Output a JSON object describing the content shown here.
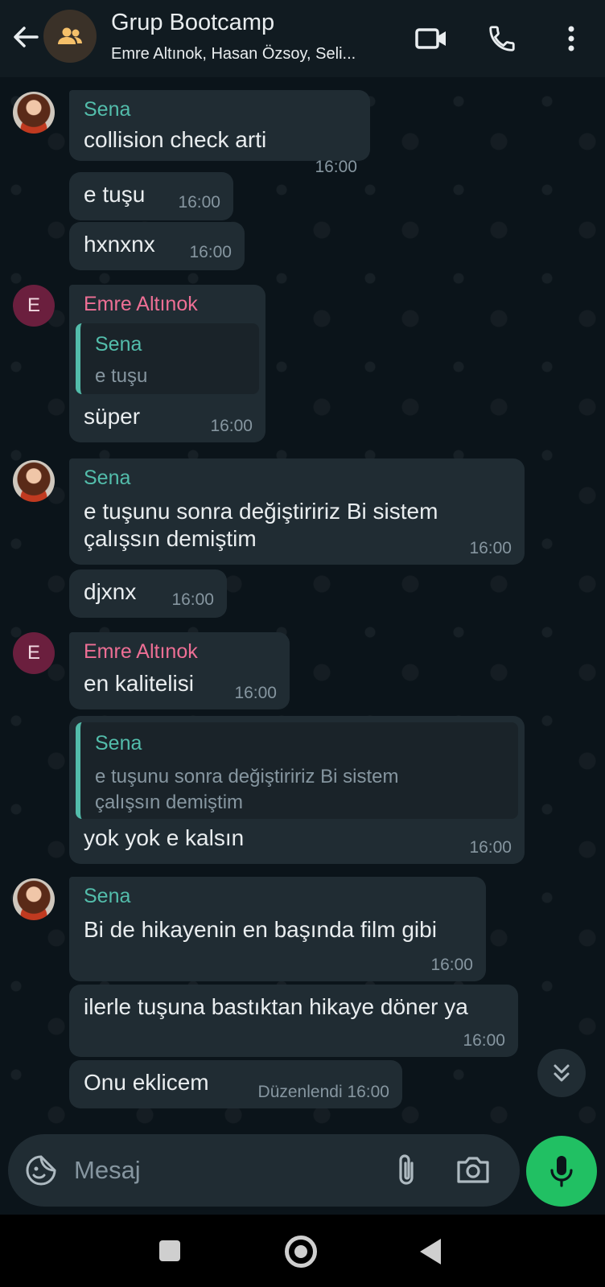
{
  "header": {
    "title": "Grup Bootcamp",
    "subtitle": "Emre Altınok, Hasan Özsoy, Seli..."
  },
  "messages": [
    {
      "sender": "Sena",
      "text": "collision check arti",
      "time": "16:00"
    },
    {
      "text": "e tuşu",
      "time": "16:00"
    },
    {
      "text": "hxnxnx",
      "time": "16:00"
    },
    {
      "sender": "Emre Altınok",
      "avatar_letter": "E",
      "quote": {
        "name": "Sena",
        "text": "e tuşu"
      },
      "text": "süper",
      "time": "16:00"
    },
    {
      "sender": "Sena",
      "text_lines": [
        "e tuşunu sonra değiştiririz Bi sistem",
        "çalışsın demiştim"
      ],
      "time": "16:00"
    },
    {
      "text": "djxnx",
      "time": "16:00"
    },
    {
      "sender": "Emre Altınok",
      "avatar_letter": "E",
      "text": "en kalitelisi",
      "time": "16:00"
    },
    {
      "quote": {
        "name": "Sena",
        "text_lines": [
          "e tuşunu sonra değiştiririz Bi sistem",
          "çalışsın demiştim"
        ]
      },
      "text": "yok yok e kalsın",
      "time": "16:00"
    },
    {
      "sender": "Sena",
      "text": "Bi de hikayenin en başında film gibi",
      "time": "16:00"
    },
    {
      "text": "ilerle tuşuna bastıktan hikaye döner ya",
      "time": "16:00"
    },
    {
      "text": "Onu eklicem",
      "time": "Düzenlendi 16:00"
    }
  ],
  "input": {
    "placeholder": "Mesaj"
  },
  "colors": {
    "header_bg": "#111b21",
    "bubble_bg": "#202c33",
    "sena_name": "#53bdab",
    "emre_name": "#ee6f95",
    "send_button": "#21c063"
  },
  "icons": [
    "back-arrow-icon",
    "group-icon",
    "video-call-icon",
    "phone-icon",
    "more-options-icon",
    "scroll-down-icon",
    "emoji-icon",
    "attach-icon",
    "camera-icon",
    "mic-icon"
  ]
}
